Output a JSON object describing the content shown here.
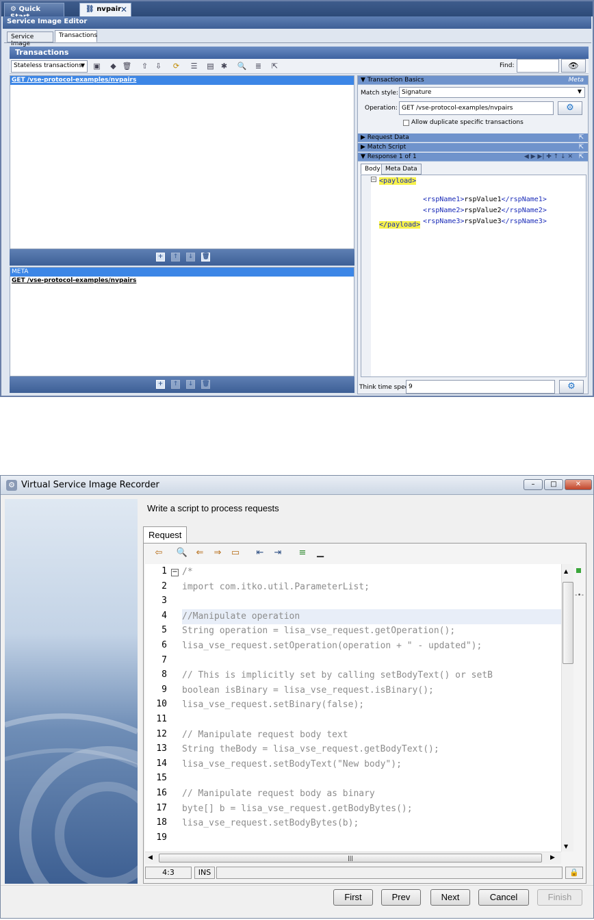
{
  "editor": {
    "tabs": [
      {
        "label": "Quick Start"
      },
      {
        "label": "nvpair"
      }
    ],
    "title": "Service Image Editor",
    "subtabs": [
      "Service Image",
      "Transactions"
    ],
    "section_title": "Transactions",
    "toolbar": {
      "mode_select": "Stateless transactions",
      "find_label": "Find:",
      "find_value": ""
    },
    "upper_list": {
      "rows": [
        "GET /vse-protocol-examples/nvpairs"
      ]
    },
    "lower_list": {
      "rows": [
        "META",
        "GET /vse-protocol-examples/nvpairs"
      ]
    },
    "right_panel": {
      "transaction_basics": "Transaction Basics",
      "meta_label": "Meta",
      "match_style_label": "Match style:",
      "match_style_value": "Signature",
      "operation_label": "Operation:",
      "operation_value": "GET /vse-protocol-examples/nvpairs",
      "allow_duplicate_label": "Allow duplicate specific transactions",
      "request_data": "Request Data",
      "match_script": "Match Script",
      "response": "Response 1 of 1",
      "body_tabs": [
        "Body",
        "Meta Data"
      ],
      "xml": {
        "open": "<payload>",
        "rows": [
          {
            "tag": "rspName1",
            "value": "rspValue1"
          },
          {
            "tag": "rspName2",
            "value": "rspValue2"
          },
          {
            "tag": "rspName3",
            "value": "rspValue3"
          }
        ],
        "close": "</payload>"
      },
      "think_time_label": "Think time spec:",
      "think_time_value": "9"
    }
  },
  "recorder": {
    "title": "Virtual Service Image Recorder",
    "instruction": "Write a script to process requests",
    "tab": "Request",
    "code": [
      {
        "n": "1",
        "text": "/*"
      },
      {
        "n": "2",
        "text": "import com.itko.util.ParameterList;"
      },
      {
        "n": "3",
        "text": ""
      },
      {
        "n": "4",
        "text": "//Manipulate operation"
      },
      {
        "n": "5",
        "text": "String operation = lisa_vse_request.getOperation();"
      },
      {
        "n": "6",
        "text": "lisa_vse_request.setOperation(operation + \" - updated\");"
      },
      {
        "n": "7",
        "text": ""
      },
      {
        "n": "8",
        "text": "// This is implicitly set by calling setBodyText() or setB"
      },
      {
        "n": "9",
        "text": "boolean isBinary = lisa_vse_request.isBinary();"
      },
      {
        "n": "10",
        "text": "lisa_vse_request.setBinary(false);"
      },
      {
        "n": "11",
        "text": ""
      },
      {
        "n": "12",
        "text": "// Manipulate request body text"
      },
      {
        "n": "13",
        "text": "String theBody = lisa_vse_request.getBodyText();"
      },
      {
        "n": "14",
        "text": "lisa_vse_request.setBodyText(\"New body\");"
      },
      {
        "n": "15",
        "text": ""
      },
      {
        "n": "16",
        "text": "// Manipulate request body as binary"
      },
      {
        "n": "17",
        "text": "byte[] b = lisa_vse_request.getBodyBytes();"
      },
      {
        "n": "18",
        "text": "lisa_vse_request.setBodyBytes(b);"
      },
      {
        "n": "19",
        "text": ""
      }
    ],
    "status": {
      "position": "4:3",
      "mode": "INS"
    },
    "buttons": {
      "first": "First",
      "prev": "Prev",
      "next": "Next",
      "cancel": "Cancel",
      "finish": "Finish"
    }
  }
}
